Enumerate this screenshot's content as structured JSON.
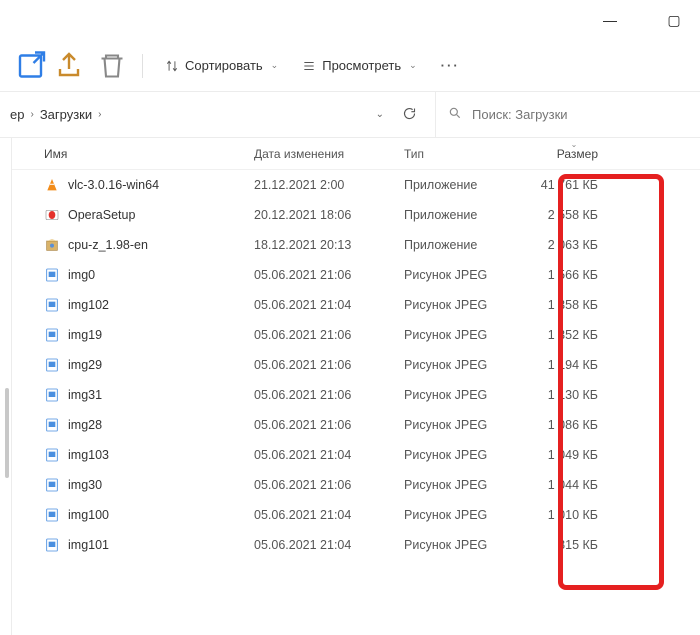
{
  "window": {
    "minimize": "—",
    "maximize": "▢"
  },
  "toolbar": {
    "sort": "Сортировать",
    "view": "Просмотреть",
    "more": "···"
  },
  "breadcrumb": {
    "seg0": "ер",
    "seg1": "Загрузки"
  },
  "search": {
    "placeholder": "Поиск: Загрузки"
  },
  "headers": {
    "name": "Имя",
    "date": "Дата изменения",
    "type": "Тип",
    "size": "Размер"
  },
  "rows": [
    {
      "icon": "cone",
      "name": "vlc-3.0.16-win64",
      "date": "21.12.2021 2:00",
      "type": "Приложение",
      "size": "41 761 КБ"
    },
    {
      "icon": "opera",
      "name": "OperaSetup",
      "date": "20.12.2021 18:06",
      "type": "Приложение",
      "size": "2 558 КБ"
    },
    {
      "icon": "box",
      "name": "cpu-z_1.98-en",
      "date": "18.12.2021 20:13",
      "type": "Приложение",
      "size": "2 063 КБ"
    },
    {
      "icon": "jpeg",
      "name": "img0",
      "date": "05.06.2021 21:06",
      "type": "Рисунок JPEG",
      "size": "1 566 КБ"
    },
    {
      "icon": "jpeg",
      "name": "img102",
      "date": "05.06.2021 21:04",
      "type": "Рисунок JPEG",
      "size": "1 358 КБ"
    },
    {
      "icon": "jpeg",
      "name": "img19",
      "date": "05.06.2021 21:06",
      "type": "Рисунок JPEG",
      "size": "1 352 КБ"
    },
    {
      "icon": "jpeg",
      "name": "img29",
      "date": "05.06.2021 21:06",
      "type": "Рисунок JPEG",
      "size": "1 194 КБ"
    },
    {
      "icon": "jpeg",
      "name": "img31",
      "date": "05.06.2021 21:06",
      "type": "Рисунок JPEG",
      "size": "1 130 КБ"
    },
    {
      "icon": "jpeg",
      "name": "img28",
      "date": "05.06.2021 21:06",
      "type": "Рисунок JPEG",
      "size": "1 086 КБ"
    },
    {
      "icon": "jpeg",
      "name": "img103",
      "date": "05.06.2021 21:04",
      "type": "Рисунок JPEG",
      "size": "1 049 КБ"
    },
    {
      "icon": "jpeg",
      "name": "img30",
      "date": "05.06.2021 21:06",
      "type": "Рисунок JPEG",
      "size": "1 044 КБ"
    },
    {
      "icon": "jpeg",
      "name": "img100",
      "date": "05.06.2021 21:04",
      "type": "Рисунок JPEG",
      "size": "1 010 КБ"
    },
    {
      "icon": "jpeg",
      "name": "img101",
      "date": "05.06.2021 21:04",
      "type": "Рисунок JPEG",
      "size": "815 КБ"
    }
  ]
}
